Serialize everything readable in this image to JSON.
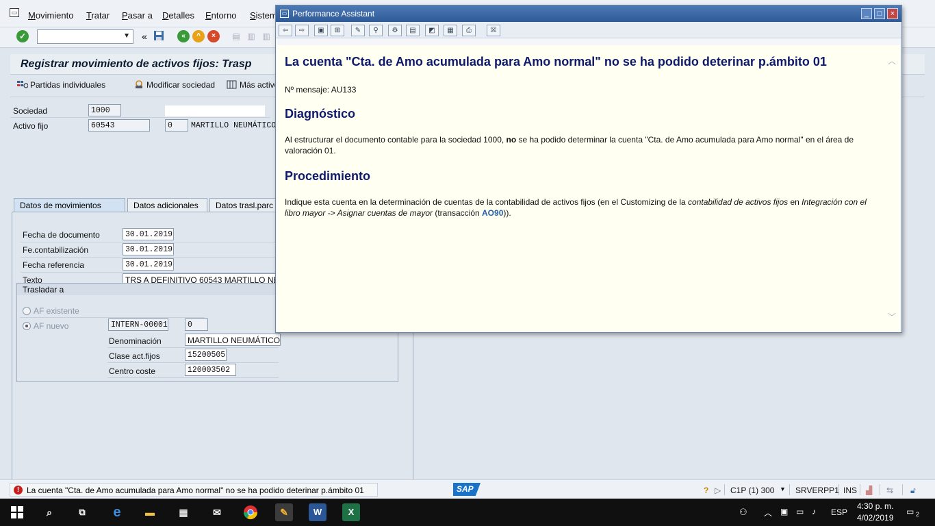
{
  "menubar": {
    "items": [
      "Movimiento",
      "Tratar",
      "Pasar a",
      "Detalles",
      "Entorno",
      "Sistem"
    ]
  },
  "toolbar": {
    "command_field_value": "",
    "nav_back_glyph": "«"
  },
  "main": {
    "title": "Registrar movimiento de activos fijos: Trasp",
    "app_toolbar": {
      "partidas": "Partidas individuales",
      "modificar": "Modificar sociedad",
      "mas": "Más activo"
    },
    "header": {
      "sociedad_label": "Sociedad",
      "sociedad_value": "1000",
      "activo_label": "Activo fijo",
      "activo_value": "60543",
      "subnum_value": "0",
      "activo_desc": "MARTILLO NEUMÁTICO"
    },
    "tabs": [
      "Datos de movimientos",
      "Datos adicionales",
      "Datos trasl.parc"
    ],
    "fields": {
      "fecha_doc_label": "Fecha de documento",
      "fecha_doc_value": "30.01.2019",
      "fecha_cont_label": "Fe.contabilización",
      "fecha_cont_value": "30.01.2019",
      "fecha_ref_label": "Fecha referencia",
      "fecha_ref_value": "30.01.2019",
      "texto_label": "Texto",
      "texto_value": "TRS A DEFINITIVO 60543 MARTILLO NE"
    },
    "trasladar": {
      "title": "Trasladar a",
      "af_existente": "AF existente",
      "af_nuevo": "AF nuevo",
      "af_nuevo_value": "INTERN-00001",
      "af_nuevo_sub": "0",
      "denominacion_label": "Denominación",
      "denominacion_value": "MARTILLO NEUMÁTICO",
      "clase_label": "Clase act.fijos",
      "clase_value": "15200505",
      "centro_label": "Centro coste",
      "centro_value": "120003502"
    }
  },
  "popup": {
    "window_title": "Performance Assistant",
    "heading": "La cuenta \"Cta. de Amo acumulada para Amo normal\" no se ha podido deterinar p.ámbito 01",
    "msg_number": "Nº mensaje: AU133",
    "diag_title": "Diagnóstico",
    "diag_text_a": "Al estructurar el documento contable para la sociedad 1000, ",
    "diag_text_bold": "no",
    "diag_text_b": " se ha podido determinar la cuenta \"Cta. de Amo acumulada para Amo normal\" en el área de valoración 01.",
    "proc_title": "Procedimiento",
    "proc_text_a": "Indique esta cuenta en la determinación de cuentas de la contabilidad de activos fijos (en el Customizing de la ",
    "proc_text_italic1": "contabilidad de activos fijos",
    "proc_text_b": " en ",
    "proc_text_italic2": "Integración con el libro mayor -> Asignar cuentas de mayor",
    "proc_text_c": " (transacción ",
    "proc_text_link": "AO90",
    "proc_text_d": "))."
  },
  "statusbar": {
    "message": "La cuenta \"Cta. de Amo acumulada para Amo normal\" no se ha podido deterinar p.ámbito 01",
    "logo": "SAP",
    "system": "C1P (1) 300",
    "server": "SRVERPP1",
    "mode": "INS"
  },
  "taskbar": {
    "language": "ESP",
    "time": "4:30 p. m.",
    "date": "4/02/2019",
    "notifications": "2"
  },
  "colors": {
    "accent": "#2e5a98",
    "heading_text": "#0f1a6a",
    "error": "#c81e1e"
  }
}
